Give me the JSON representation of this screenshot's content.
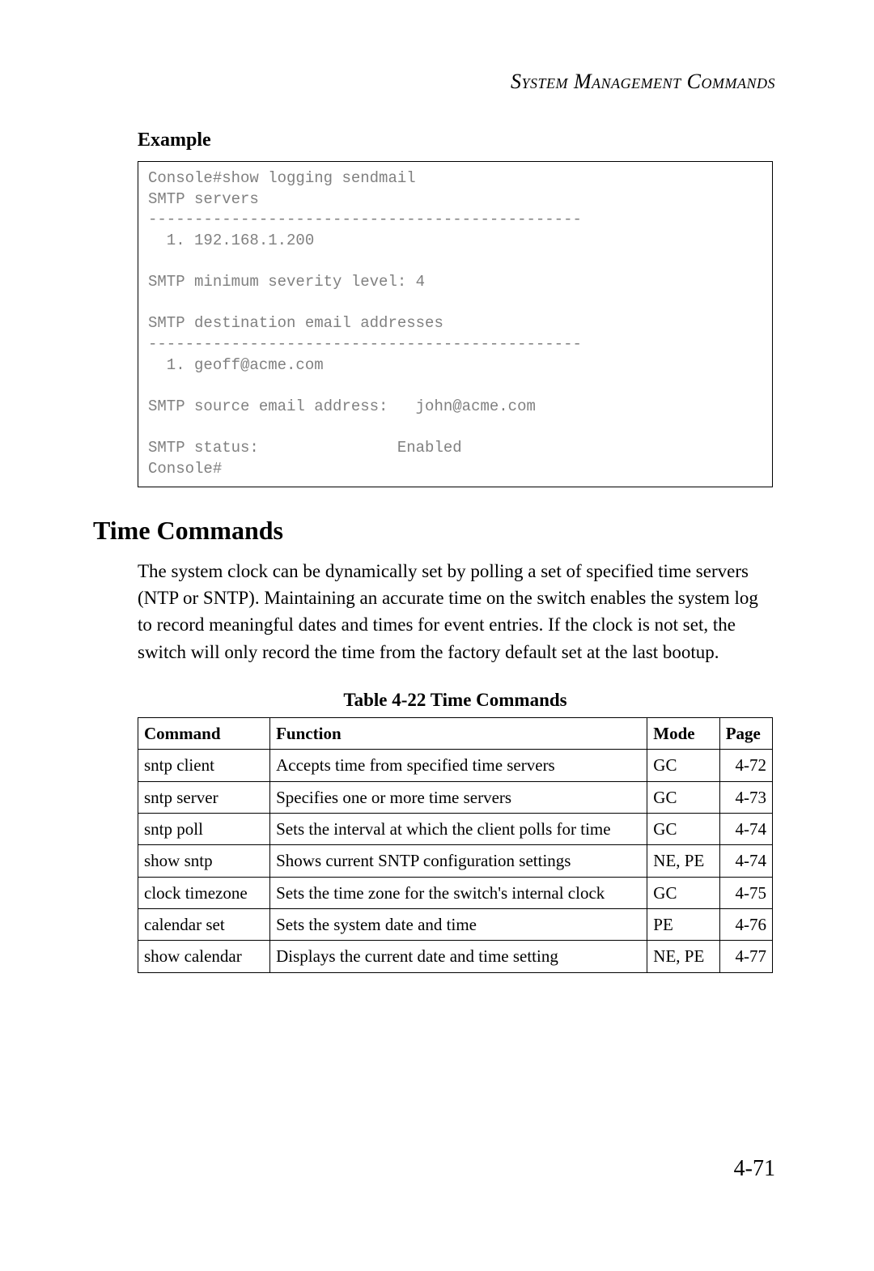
{
  "header": "System Management Commands",
  "example": {
    "heading": "Example",
    "console": "Console#show logging sendmail\nSMTP servers\n-----------------------------------------------\n  1. 192.168.1.200\n\nSMTP minimum severity level: 4\n\nSMTP destination email addresses\n-----------------------------------------------\n  1. geoff@acme.com\n\nSMTP source email address:   john@acme.com\n\nSMTP status:               Enabled\nConsole#"
  },
  "section": {
    "heading": "Time Commands",
    "body": "The system clock can be dynamically set by polling a set of specified time servers (NTP or SNTP). Maintaining an accurate time on the switch enables the system log to record meaningful dates and times for event entries. If the clock is not set, the switch will only record the time from the factory default set at the last bootup."
  },
  "table": {
    "caption": "Table 4-22  Time Commands",
    "headers": [
      "Command",
      "Function",
      "Mode",
      "Page"
    ],
    "rows": [
      {
        "command": "sntp client",
        "function": "Accepts time from specified time servers",
        "mode": "GC",
        "page": "4-72"
      },
      {
        "command": "sntp server",
        "function": "Specifies one or more time servers",
        "mode": "GC",
        "page": "4-73"
      },
      {
        "command": "sntp poll",
        "function": "Sets the interval at which the client polls for time",
        "mode": "GC",
        "page": "4-74"
      },
      {
        "command": "show sntp",
        "function": "Shows current SNTP configuration settings",
        "mode": "NE, PE",
        "page": "4-74"
      },
      {
        "command": "clock timezone",
        "function": "Sets the time zone for the switch's internal clock",
        "mode": "GC",
        "page": "4-75"
      },
      {
        "command": "calendar set",
        "function": "Sets the system date and time",
        "mode": "PE",
        "page": "4-76"
      },
      {
        "command": "show calendar",
        "function": "Displays the current date and time setting",
        "mode": "NE, PE",
        "page": "4-77"
      }
    ]
  },
  "page_number": "4-71"
}
